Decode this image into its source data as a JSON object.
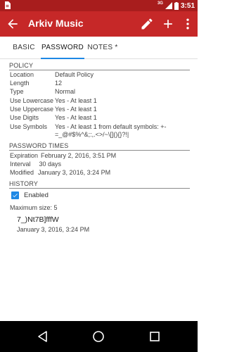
{
  "status_bar": {
    "time": "3:51",
    "network": "3G"
  },
  "app_bar": {
    "title": "Arkiv Music"
  },
  "tabs": [
    {
      "label": "BASIC",
      "active": false
    },
    {
      "label": "PASSWORD",
      "active": true
    },
    {
      "label": "NOTES *",
      "active": false
    }
  ],
  "policy": {
    "heading": "POLICY",
    "rows": [
      {
        "label": "Location",
        "value": "Default Policy"
      },
      {
        "label": "Length",
        "value": "12"
      },
      {
        "label": "Type",
        "value": "Normal"
      },
      {
        "label": "Use Lowercase",
        "value": "Yes - At least 1"
      },
      {
        "label": "Use Uppercase",
        "value": "Yes - At least 1"
      },
      {
        "label": "Use Digits",
        "value": "Yes - At least 1"
      },
      {
        "label": "Use Symbols",
        "value": "Yes - At least 1 from default symbols: +-=_@#$%^&;:,.<>/~\\[](){}?!|"
      }
    ]
  },
  "password_times": {
    "heading": "PASSWORD TIMES",
    "expiration_label": "Expiration",
    "expiration_value": "February 2, 2016, 3:51 PM",
    "interval_label": "Interval",
    "interval_value": "30 days",
    "modified_label": "Modified",
    "modified_value": "January 3, 2016, 3:24 PM"
  },
  "history": {
    "heading": "HISTORY",
    "enabled_label": "Enabled",
    "enabled_checked": true,
    "max_size": "Maximum size: 5",
    "entries": [
      {
        "password": "7_)Nt7B]fffW",
        "date": "January 3, 2016, 3:24 PM"
      }
    ]
  },
  "colors": {
    "app_bar": "#c62828",
    "status_bar": "#a81d1d",
    "accent": "#1e88e5"
  },
  "icons": [
    "notification-icon",
    "signal-icon",
    "battery-icon",
    "back-arrow-icon",
    "edit-icon",
    "add-icon",
    "overflow-menu-icon",
    "checkbox-checked-icon",
    "nav-back-icon",
    "nav-home-icon",
    "nav-recents-icon"
  ]
}
